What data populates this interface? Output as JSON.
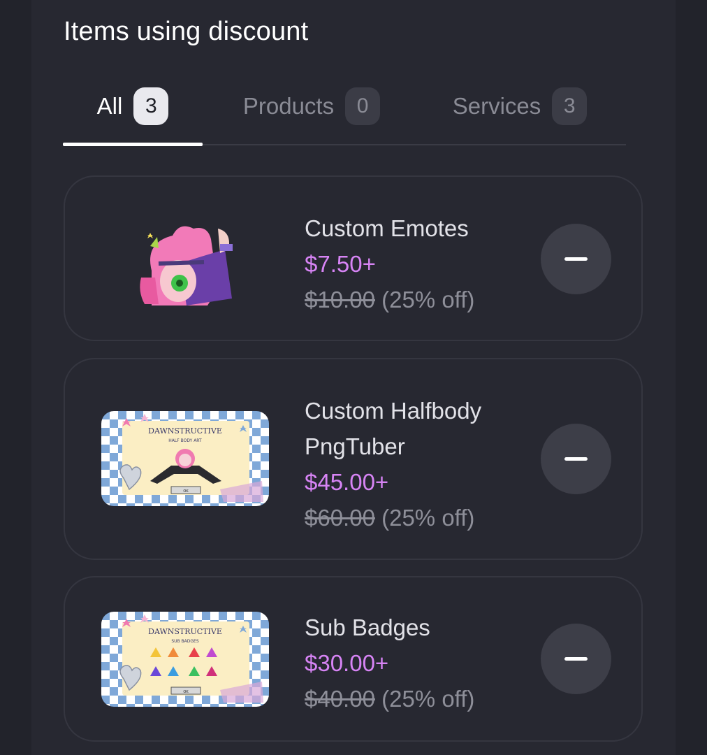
{
  "section": {
    "title": "Items using discount"
  },
  "tabs": [
    {
      "label": "All",
      "count": "3",
      "active": true
    },
    {
      "label": "Products",
      "count": "0",
      "active": false
    },
    {
      "label": "Services",
      "count": "3",
      "active": false
    }
  ],
  "items": [
    {
      "name": "Custom Emotes",
      "price": "$7.50+",
      "original_price": "$10.00",
      "discount": "(25% off)"
    },
    {
      "name": "Custom Halfbody PngTuber",
      "price": "$45.00+",
      "original_price": "$60.00",
      "discount": "(25% off)",
      "thumb_title": "DAWNSTRUCTIVE",
      "thumb_subtitle": "HALF BODY ART",
      "thumb_button": "OK"
    },
    {
      "name": "Sub Badges",
      "price": "$30.00+",
      "original_price": "$40.00",
      "discount": "(25% off)",
      "thumb_title": "DAWNSTRUCTIVE",
      "thumb_subtitle": "SUB BADGES",
      "thumb_button": "OK"
    }
  ],
  "colors": {
    "background": "#22232b",
    "panel": "#272831",
    "price_accent": "#d784f5",
    "card_border": "#353640"
  },
  "icons": {
    "remove": "minus-icon"
  }
}
